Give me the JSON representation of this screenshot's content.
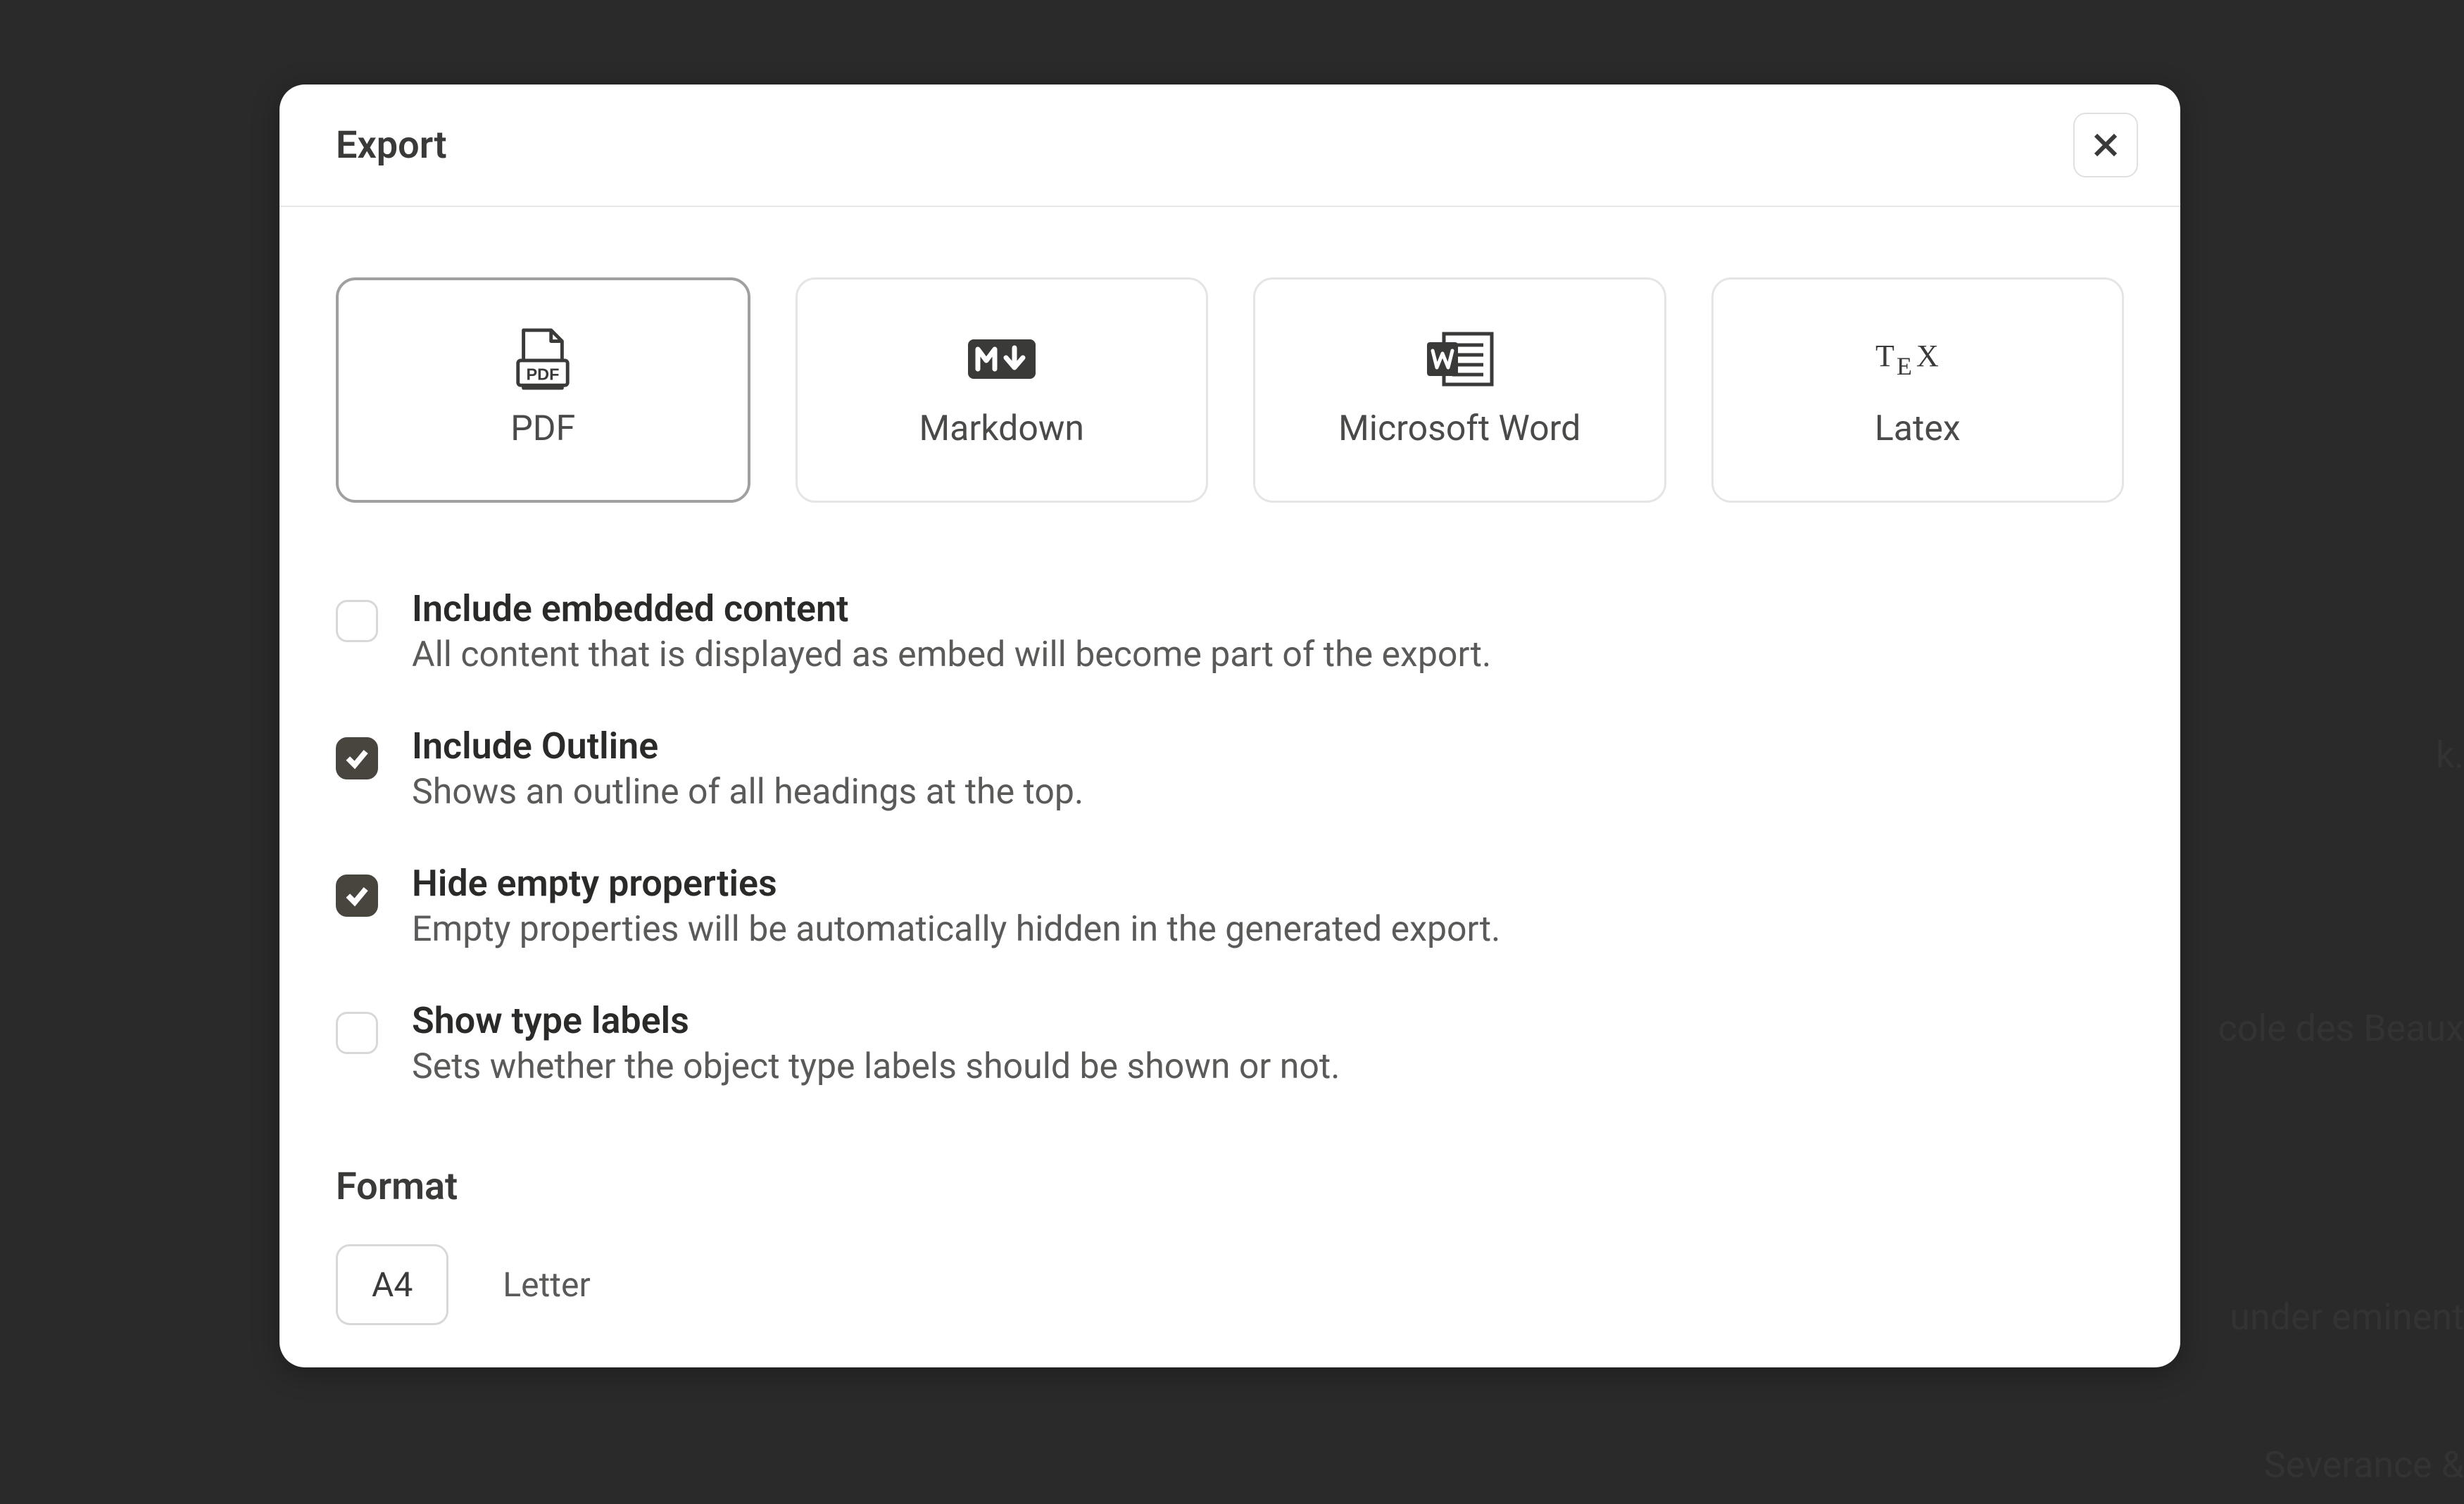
{
  "dialog": {
    "title": "Export",
    "formats": [
      {
        "id": "pdf",
        "label": "PDF",
        "selected": true
      },
      {
        "id": "markdown",
        "label": "Markdown",
        "selected": false
      },
      {
        "id": "word",
        "label": "Microsoft Word",
        "selected": false
      },
      {
        "id": "latex",
        "label": "Latex",
        "selected": false
      }
    ],
    "options": [
      {
        "id": "include-embedded",
        "title": "Include embedded content",
        "desc": "All content that is displayed as embed will become part of the export.",
        "checked": false
      },
      {
        "id": "include-outline",
        "title": "Include Outline",
        "desc": "Shows an outline of all headings at the top.",
        "checked": true
      },
      {
        "id": "hide-empty",
        "title": "Hide empty properties",
        "desc": "Empty properties will be automatically hidden in the generated export.",
        "checked": true
      },
      {
        "id": "show-type-labels",
        "title": "Show type labels",
        "desc": "Sets whether the object type labels should be shown or not.",
        "checked": false
      }
    ],
    "page_format": {
      "title": "Format",
      "options": [
        {
          "id": "a4",
          "label": "A4",
          "selected": true
        },
        {
          "id": "letter",
          "label": "Letter",
          "selected": false
        }
      ]
    }
  },
  "background_snippets": {
    "s1": "k.",
    "s2": "cole des Beaux",
    "s3": "under eminent",
    "s4": "Severance & "
  }
}
